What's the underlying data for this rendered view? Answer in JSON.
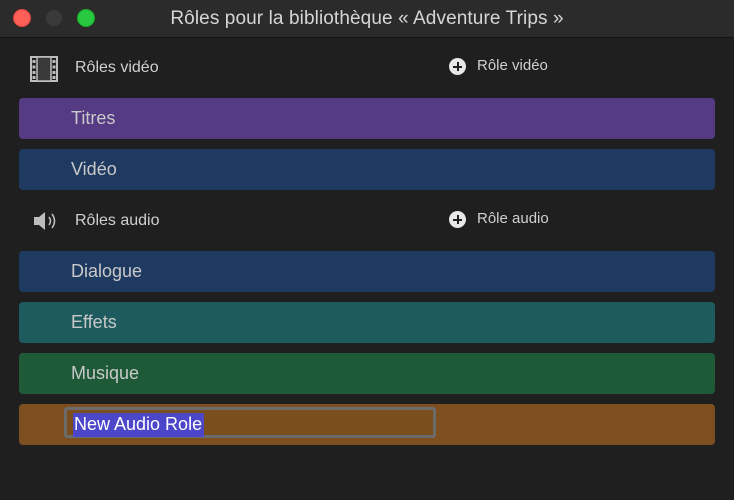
{
  "window": {
    "title": "Rôles pour la bibliothèque « Adventure Trips »"
  },
  "video_section": {
    "label": "Rôles vidéo",
    "icon": "film-icon",
    "add_label": "Rôle vidéo",
    "roles": [
      {
        "label": "Titres",
        "color": "#553a84"
      },
      {
        "label": "Vidéo",
        "color": "#1f3a60"
      }
    ]
  },
  "audio_section": {
    "label": "Rôles audio",
    "icon": "speaker-icon",
    "add_label": "Rôle audio",
    "roles": [
      {
        "label": "Dialogue",
        "color": "#1f3a60"
      },
      {
        "label": "Effets",
        "color": "#1e5b5f"
      },
      {
        "label": "Musique",
        "color": "#1e5a38"
      }
    ],
    "editing_role": {
      "value": "New Audio Role",
      "color": "#7d4e1f"
    }
  }
}
